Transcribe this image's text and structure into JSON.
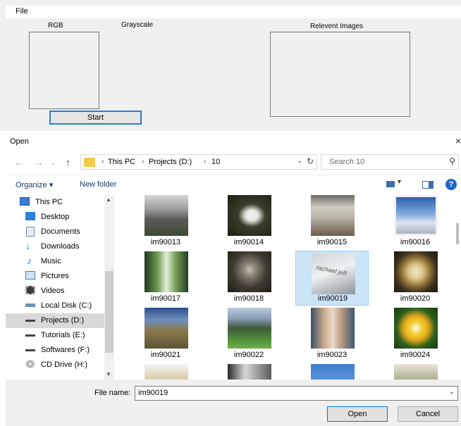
{
  "app": {
    "menu_file": "File",
    "label_rgb": "RGB",
    "label_grayscale": "Grayscale",
    "label_relevant": "Relevent Images",
    "start_button": "Start"
  },
  "dialog": {
    "title": "Open",
    "close": "×",
    "breadcrumbs": [
      "This PC",
      "Projects (D:)",
      "10"
    ],
    "search_placeholder": "Search 10",
    "organize": "Organize ▾",
    "new_folder": "New folder",
    "help": "?",
    "nav": [
      {
        "label": "This PC",
        "icon": "pc-icon"
      },
      {
        "label": "Desktop",
        "icon": "desktop-icon"
      },
      {
        "label": "Documents",
        "icon": "documents-icon"
      },
      {
        "label": "Downloads",
        "icon": "downloads-icon"
      },
      {
        "label": "Music",
        "icon": "music-icon"
      },
      {
        "label": "Pictures",
        "icon": "pictures-icon"
      },
      {
        "label": "Videos",
        "icon": "videos-icon"
      },
      {
        "label": "Local Disk (C:)",
        "icon": "drive-icon"
      },
      {
        "label": "Projects (D:)",
        "icon": "drive-icon",
        "selected": true
      },
      {
        "label": "Tutorials (E:)",
        "icon": "drive-icon"
      },
      {
        "label": "Softwares (F:)",
        "icon": "drive-icon"
      },
      {
        "label": "CD Drive (H:)",
        "icon": "cd-drive-icon"
      }
    ],
    "files": [
      {
        "name": "im90013"
      },
      {
        "name": "im90014"
      },
      {
        "name": "im90015"
      },
      {
        "name": "im90016"
      },
      {
        "name": "im90017"
      },
      {
        "name": "im90018"
      },
      {
        "name": "im90019",
        "selected": true
      },
      {
        "name": "im90020"
      },
      {
        "name": "im90021"
      },
      {
        "name": "im90022"
      },
      {
        "name": "im90023"
      },
      {
        "name": "im90024"
      }
    ],
    "thumb_text": "rachael jeff",
    "file_name_label": "File name:",
    "file_name_value": "im90019",
    "open_button": "Open",
    "cancel_button": "Cancel",
    "colors": {
      "accent": "#0078d7",
      "selection": "#cce4f7",
      "start_border": "#2a7bd6"
    }
  }
}
